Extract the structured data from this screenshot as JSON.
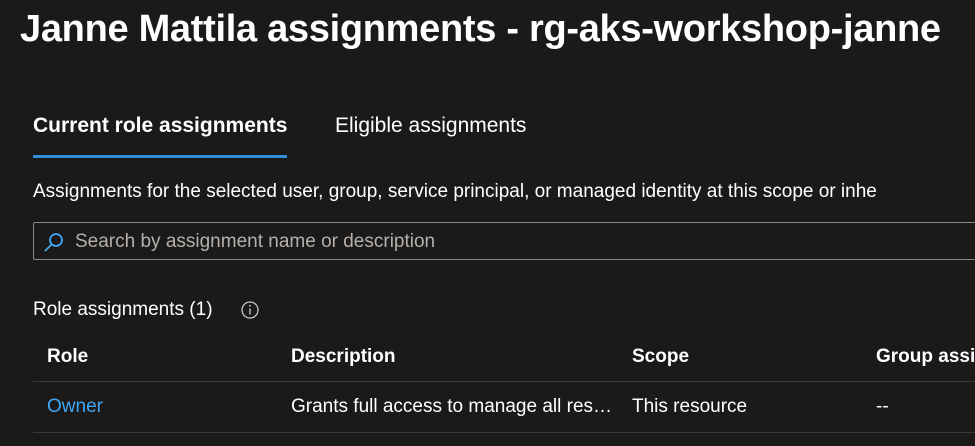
{
  "page": {
    "title": "Janne Mattila assignments - rg-aks-workshop-janne"
  },
  "tabs": [
    {
      "label": "Current role assignments",
      "selected": true
    },
    {
      "label": "Eligible assignments",
      "selected": false
    }
  ],
  "description": "Assignments for the selected user, group, service principal, or managed identity at this scope or inhe",
  "search": {
    "placeholder": "Search by assignment name or description",
    "value": ""
  },
  "role_assignments": {
    "title": "Role assignments (1)",
    "columns": [
      "Role",
      "Description",
      "Scope",
      "Group assi"
    ],
    "rows": [
      {
        "role": "Owner",
        "description": "Grants full access to manage all resources, including the ability to assign roles in Azure RBAC.",
        "scope": "This resource",
        "group_assignment": "--"
      }
    ]
  },
  "colors": {
    "background": "#1b1a19",
    "accent": "#2f8fdf",
    "link": "#3fa7f5",
    "border": "#8a8886"
  }
}
